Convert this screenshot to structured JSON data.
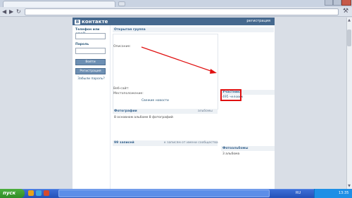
{
  "browser": {
    "tab_label": "",
    "url": "",
    "back_glyph": "◀",
    "forward_glyph": "▶",
    "reload_glyph": "↻",
    "menu_glyph": "⚒"
  },
  "vk": {
    "brand": "контакте",
    "logo_letter": "В",
    "register_link": "регистрация",
    "login": {
      "phone_label": "Телефон или email",
      "password_label": "Пароль",
      "login_button": "Войти",
      "register_button": "Регистрация",
      "forgot_link": "Забыли пароль?"
    },
    "group": {
      "title": "Открытая группа",
      "description_label": "Описание:",
      "website_label": "Веб-сайт:",
      "location_label": "Местоположение:",
      "news_link": "Свежие новости",
      "photos": {
        "header": "Фотографии",
        "albums_link": "альбомы",
        "summary": "8 основном альбоме 8 фотографий"
      },
      "wall": {
        "header": "99 записей",
        "link": "к записям от имени сообщества"
      },
      "members": {
        "header": "Участники",
        "count": "495 человек"
      },
      "albums": {
        "header": "Фотоальбомы",
        "count": "3 альбома"
      }
    }
  },
  "taskbar": {
    "start_label": "пуск",
    "language": "RU",
    "clock": "13:35"
  },
  "colors": {
    "vk_header": "#45688e",
    "highlight": "#e01010",
    "taskbar": "#2451b8",
    "start": "#2f8c26"
  }
}
